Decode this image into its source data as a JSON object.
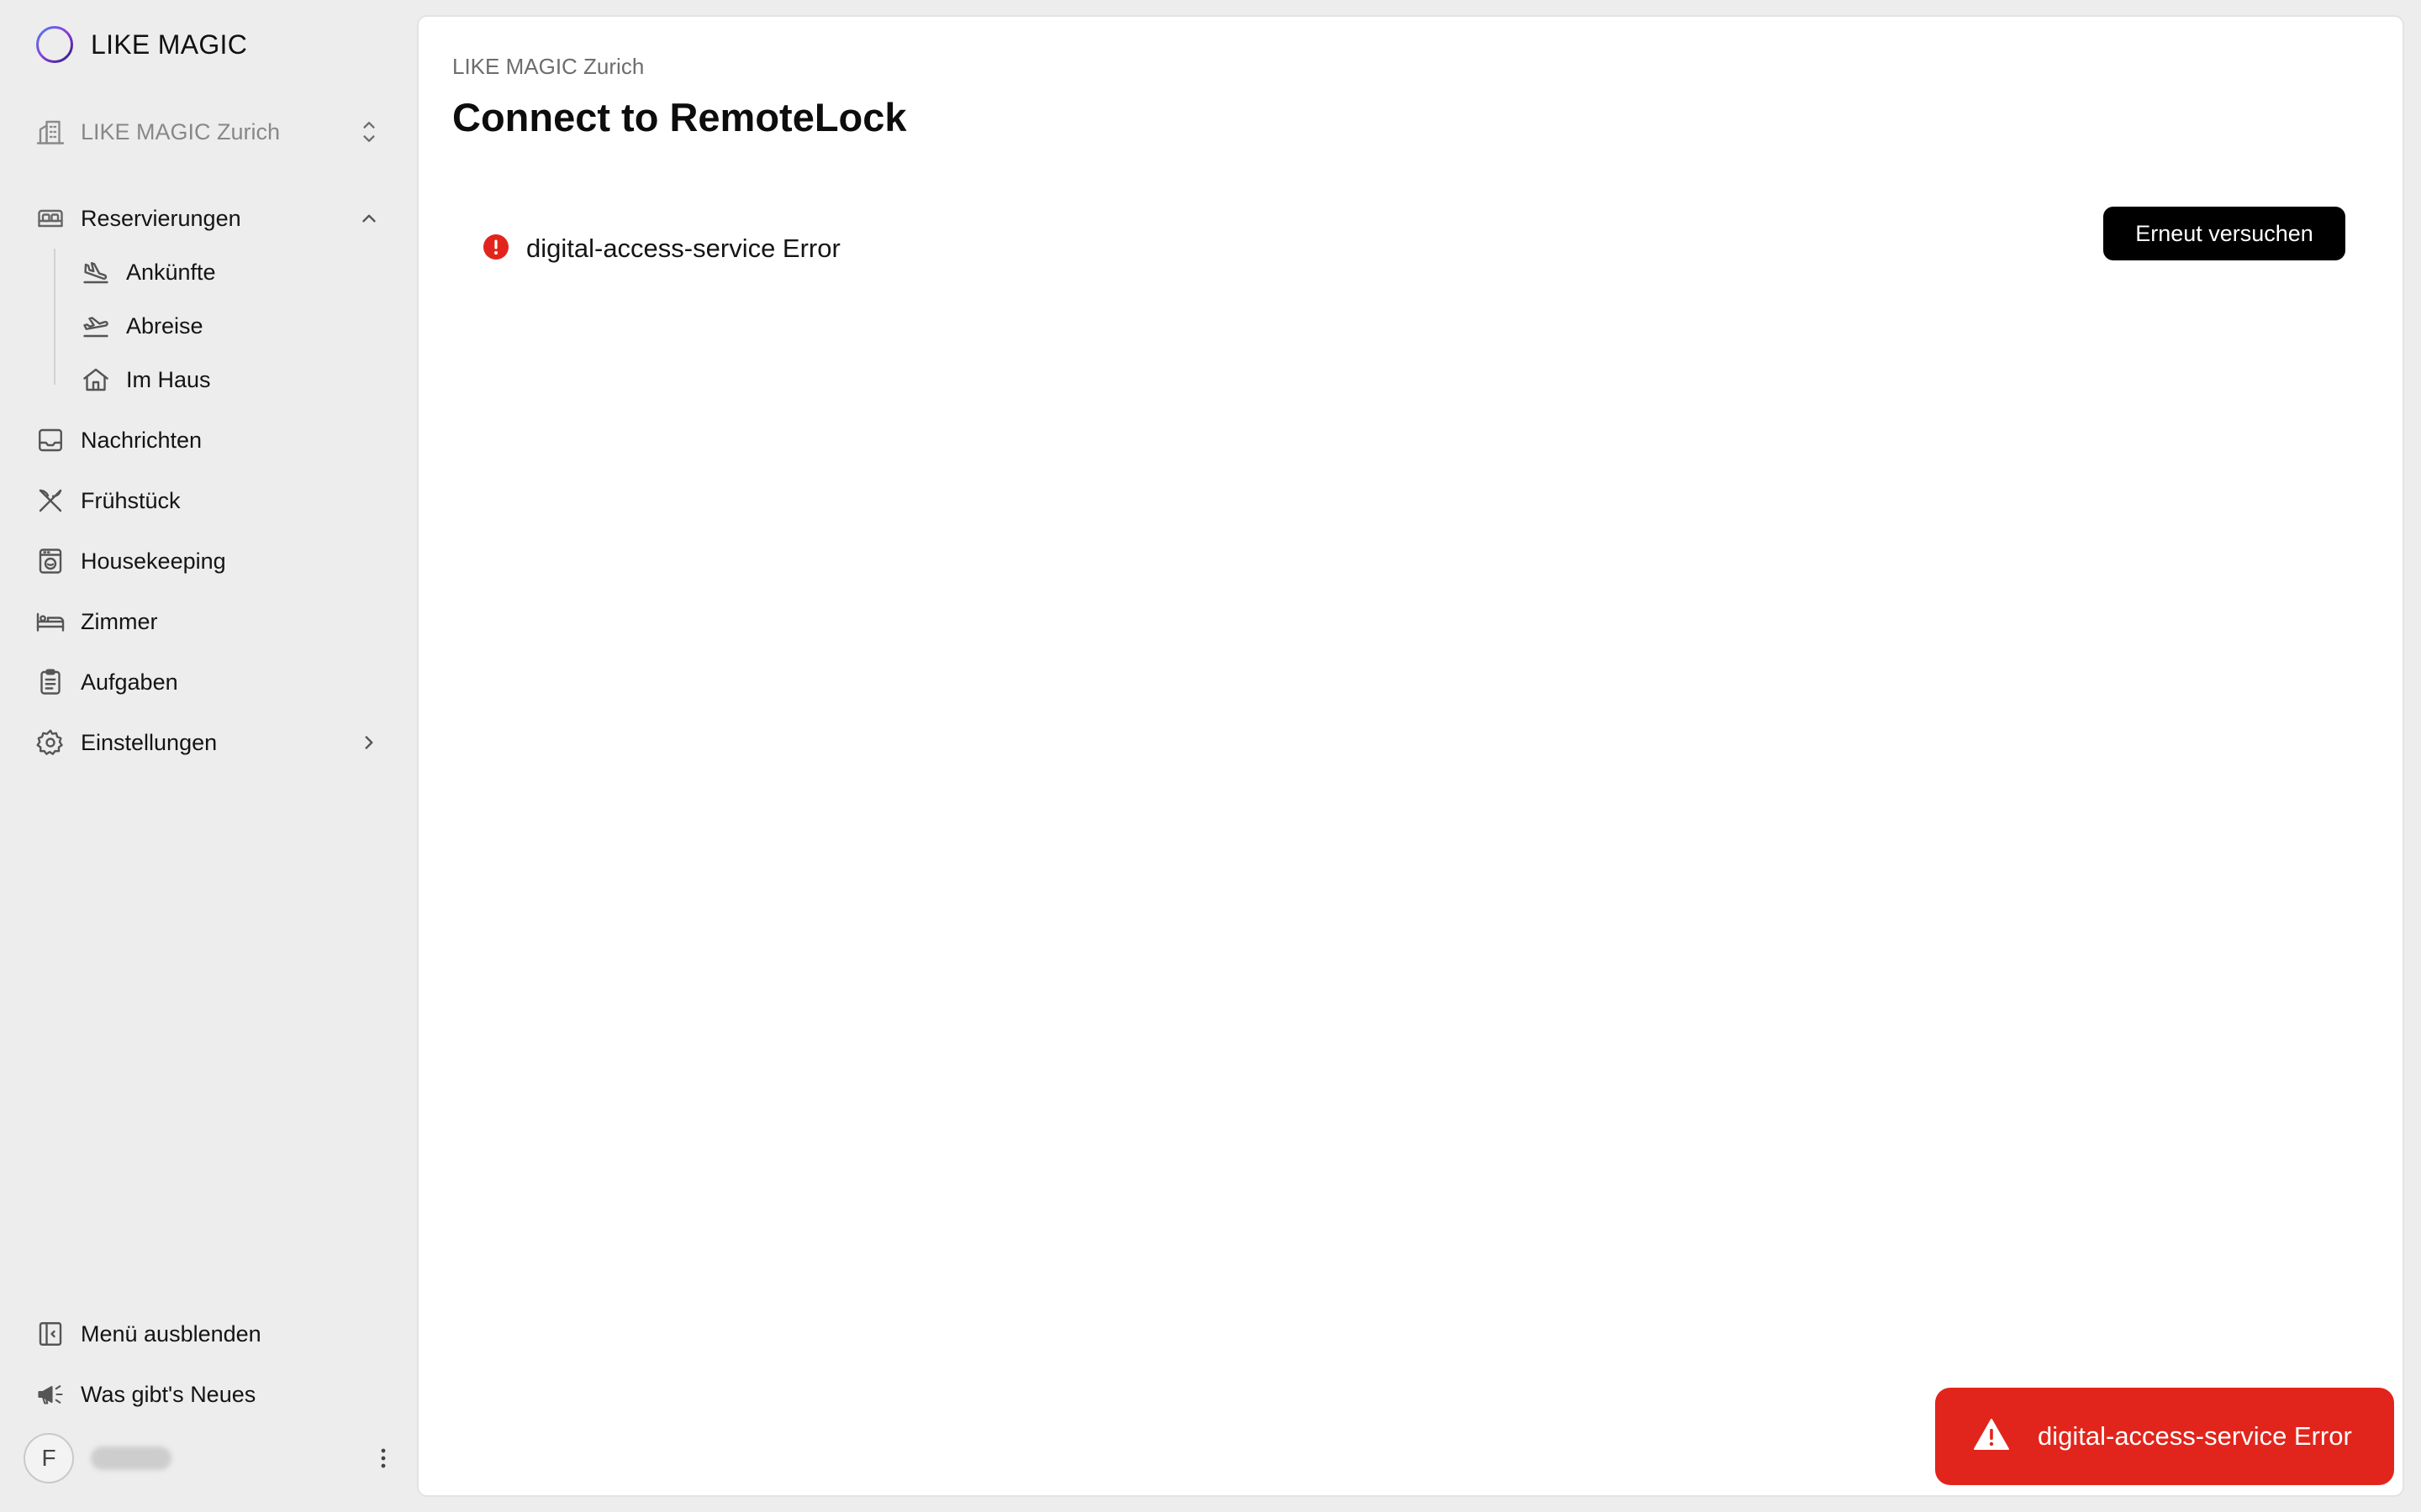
{
  "brand": {
    "name": "LIKE MAGIC"
  },
  "property_selector": {
    "label": "LIKE MAGIC Zurich"
  },
  "sidebar": {
    "items": [
      {
        "label": "Reservierungen"
      },
      {
        "label": "Ankünfte"
      },
      {
        "label": "Abreise"
      },
      {
        "label": "Im Haus"
      },
      {
        "label": "Nachrichten"
      },
      {
        "label": "Frühstück"
      },
      {
        "label": "Housekeeping"
      },
      {
        "label": "Zimmer"
      },
      {
        "label": "Aufgaben"
      },
      {
        "label": "Einstellungen"
      }
    ],
    "footer": [
      {
        "label": "Menü ausblenden"
      },
      {
        "label": "Was gibt's Neues"
      }
    ]
  },
  "user": {
    "initial": "F"
  },
  "main": {
    "breadcrumb": "LIKE MAGIC Zurich",
    "title": "Connect to RemoteLock",
    "error_message": "digital-access-service Error",
    "retry_label": "Erneut versuchen"
  },
  "toast": {
    "message": "digital-access-service Error"
  },
  "colors": {
    "error_red": "#e2251c",
    "button_black": "#000000",
    "sidebar_bg": "#ededed",
    "content_bg": "#ffffff",
    "muted_text": "#888888"
  },
  "icons": {
    "brand": "circle-logo-icon",
    "property": "building-icon",
    "reservations": "bed-icon",
    "arrivals": "plane-landing-icon",
    "departures": "plane-takeoff-icon",
    "in_house": "home-icon",
    "messages": "inbox-icon",
    "breakfast": "utensils-icon",
    "housekeeping": "washing-machine-icon",
    "rooms": "bed-single-icon",
    "tasks": "clipboard-icon",
    "settings": "gear-icon",
    "collapse_menu": "sidebar-collapse-icon",
    "whats_new": "megaphone-icon"
  }
}
